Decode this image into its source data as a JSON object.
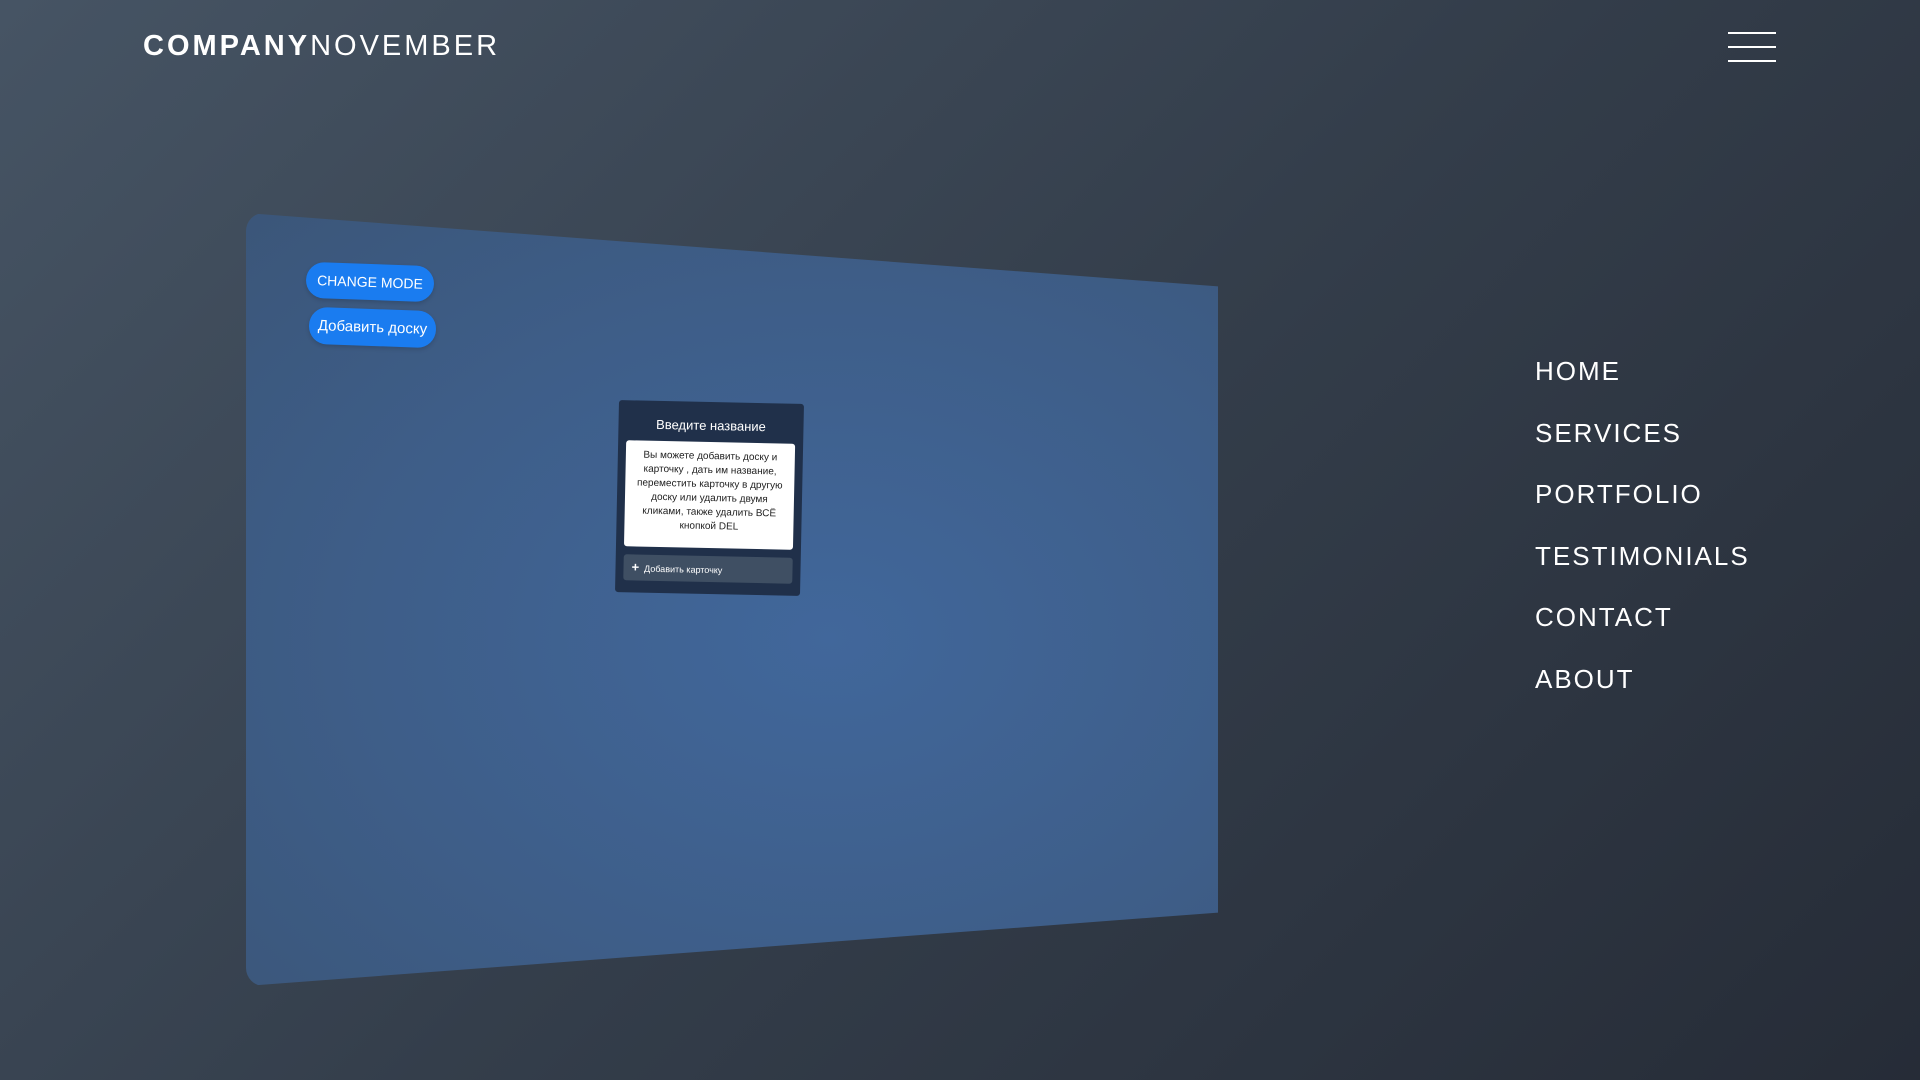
{
  "brand": {
    "bold": "COMPANY",
    "light": "NOVEMBER"
  },
  "menu_icon": "hamburger-menu-icon",
  "nav": {
    "items": [
      {
        "label": "HOME"
      },
      {
        "label": "SERVICES"
      },
      {
        "label": "PORTFOLIO"
      },
      {
        "label": "TESTIMONIALS"
      },
      {
        "label": "CONTACT"
      },
      {
        "label": "ABOUT"
      }
    ]
  },
  "board": {
    "change_mode_label": "CHANGE MODE",
    "add_board_label": "Добавить доску",
    "column": {
      "title": "Введите название",
      "card_text": "Вы можете добавить доску и карточку , дать им название, переместить карточку в другую доску или удалить двумя кликами, также удалить ВСЁ кнопкой DEL",
      "add_card_icon": "plus-icon",
      "add_card_label": "Добавить карточку"
    }
  },
  "colors": {
    "accent": "#1a7cf0",
    "column_bg": "#20304a",
    "board_bg": "#41679b"
  }
}
